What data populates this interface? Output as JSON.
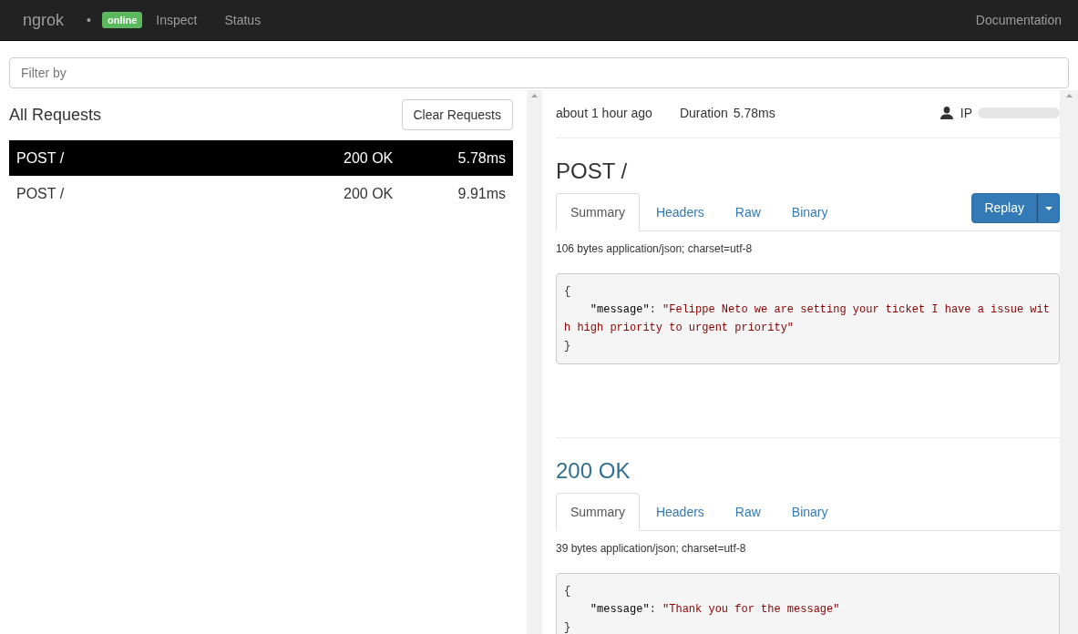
{
  "nav": {
    "brand": "ngrok",
    "separator": "•",
    "status_badge": "online",
    "links": [
      {
        "label": "Inspect"
      },
      {
        "label": "Status"
      }
    ],
    "right_link": "Documentation"
  },
  "filter": {
    "placeholder": "Filter by"
  },
  "requests": {
    "title": "All Requests",
    "clear_button": "Clear Requests",
    "rows": [
      {
        "request": "POST /",
        "status": "200 OK",
        "duration": "5.78ms",
        "selected": true
      },
      {
        "request": "POST /",
        "status": "200 OK",
        "duration": "9.91ms",
        "selected": false
      }
    ]
  },
  "detail": {
    "time": "about 1 hour ago",
    "duration_label": "Duration",
    "duration": "5.78ms",
    "ip_label": "IP",
    "request": {
      "title": "POST /",
      "tabs": [
        {
          "label": "Summary",
          "selected": true
        },
        {
          "label": "Headers",
          "selected": false
        },
        {
          "label": "Raw",
          "selected": false
        },
        {
          "label": "Binary",
          "selected": false
        }
      ],
      "replay_button": "Replay",
      "meta": "106 bytes application/json; charset=utf-8",
      "body": {
        "open": "{",
        "entries": [
          {
            "key": "\"message\"",
            "separator": ":",
            "value": "\"Felippe Neto we are setting your ticket I have a issue with high priority to urgent priority\""
          }
        ],
        "close": "}"
      }
    },
    "response": {
      "title": "200 OK",
      "tabs": [
        {
          "label": "Summary",
          "selected": true
        },
        {
          "label": "Headers",
          "selected": false
        },
        {
          "label": "Raw",
          "selected": false
        },
        {
          "label": "Binary",
          "selected": false
        }
      ],
      "meta": "39 bytes application/json; charset=utf-8",
      "body": {
        "open": "{",
        "entries": [
          {
            "key": "\"message\"",
            "separator": ":",
            "value": "\"Thank you for the message\""
          }
        ],
        "close": "}"
      }
    }
  }
}
